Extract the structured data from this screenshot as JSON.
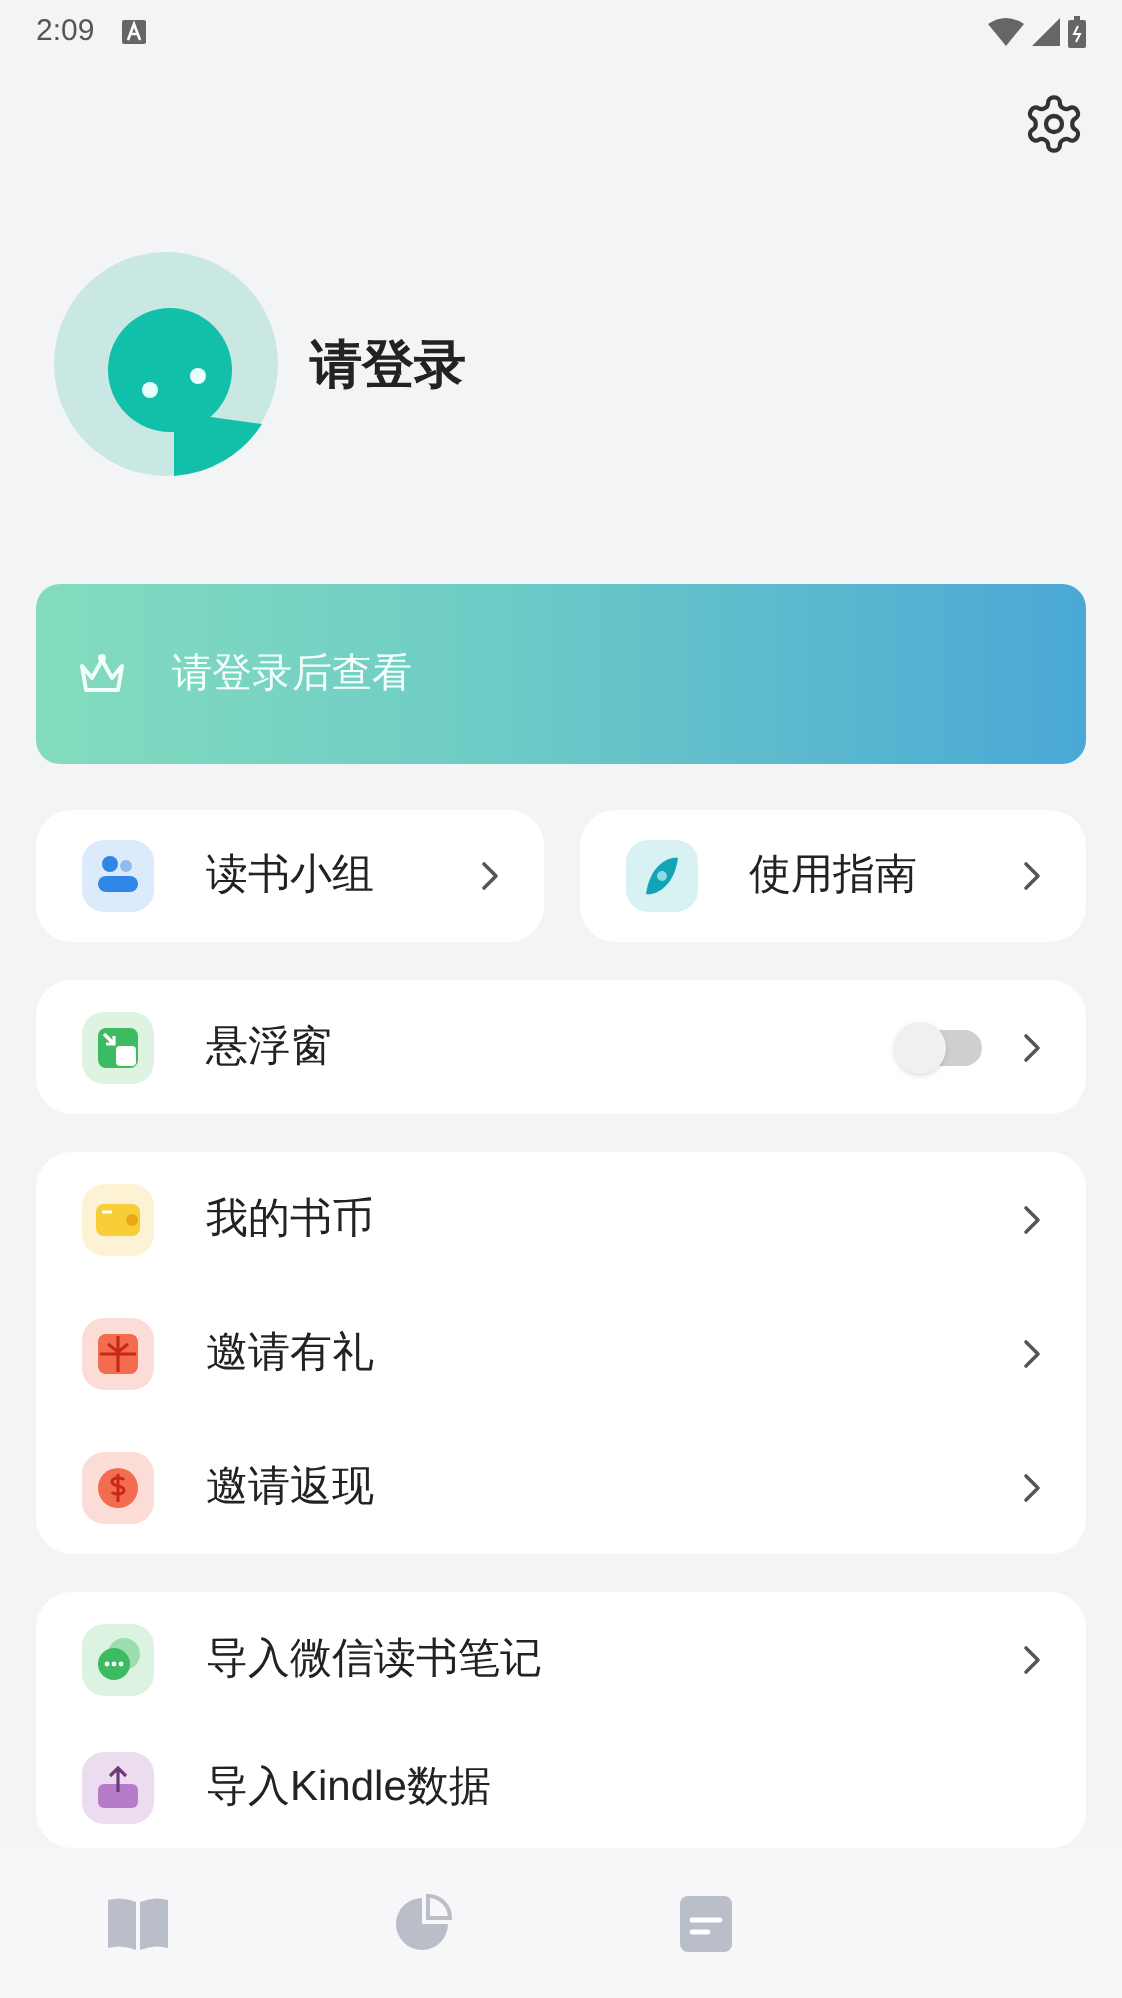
{
  "status_bar": {
    "time": "2:09"
  },
  "profile": {
    "name": "请登录"
  },
  "vip_banner": {
    "text": "请登录后查看"
  },
  "shortcuts": [
    {
      "label": "读书小组"
    },
    {
      "label": "使用指南"
    }
  ],
  "floating_window": {
    "label": "悬浮窗",
    "on": false
  },
  "groups": [
    [
      {
        "label": "我的书币"
      },
      {
        "label": "邀请有礼"
      },
      {
        "label": "邀请返现"
      }
    ],
    [
      {
        "label": "导入微信读书笔记",
        "chevron": true
      },
      {
        "label": "导入Kindle数据",
        "chevron": false
      }
    ]
  ],
  "bottom_nav": [
    {
      "selected": false
    },
    {
      "selected": false
    },
    {
      "selected": false
    }
  ]
}
